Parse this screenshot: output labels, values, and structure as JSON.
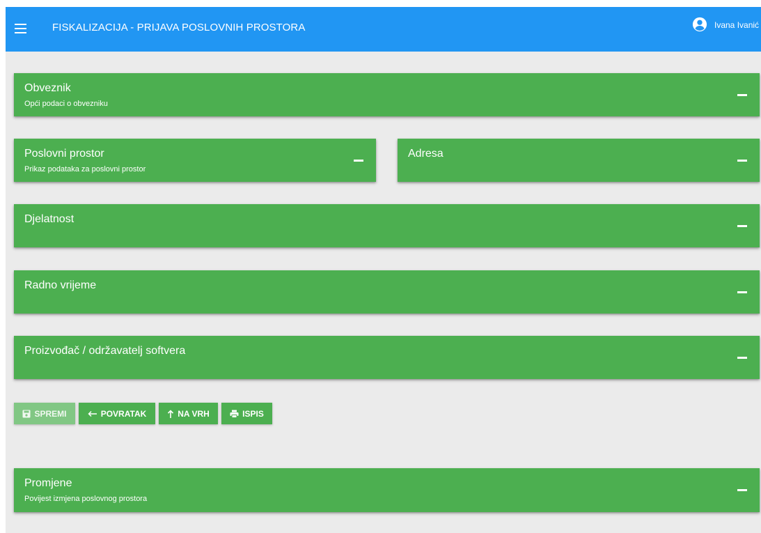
{
  "header": {
    "menu_icon": "hamburger-icon",
    "title": "FISKALIZACIJA - PRIJAVA POSLOVNIH PROSTORA",
    "user_icon": "account-circle-icon",
    "user_name": "Ivana Ivanić",
    "colors": {
      "bar": "#2196f3",
      "text": "#ffffff"
    }
  },
  "panels": {
    "obveznik": {
      "title": "Obveznik",
      "subtitle": "Opći podaci o obvezniku",
      "toggle_icon": "minus-icon"
    },
    "poslovni_prostor": {
      "title": "Poslovni prostor",
      "subtitle": "Prikaz podataka za poslovni prostor",
      "toggle_icon": "minus-icon"
    },
    "adresa": {
      "title": "Adresa",
      "toggle_icon": "minus-icon"
    },
    "djelatnost": {
      "title": "Djelatnost",
      "toggle_icon": "minus-icon"
    },
    "radno_vrijeme": {
      "title": "Radno vrijeme",
      "toggle_icon": "minus-icon"
    },
    "softver": {
      "title": "Proizvođač / održavatelj softvera",
      "toggle_icon": "minus-icon"
    },
    "promjene": {
      "title": "Promjene",
      "subtitle": "Povijest izmjena poslovnog prostora",
      "toggle_icon": "minus-icon"
    }
  },
  "actions": {
    "save": {
      "label": "SPREMI",
      "icon": "save-icon",
      "disabled": true
    },
    "back": {
      "label": "POVRATAK",
      "icon": "return-arrow-icon"
    },
    "top": {
      "label": "NA VRH",
      "icon": "arrow-up-icon"
    },
    "print": {
      "label": "ISPIS",
      "icon": "print-icon"
    }
  },
  "colors": {
    "panel": "#4caf50",
    "panel_disabled": "#81c784",
    "background": "#ebebeb"
  }
}
